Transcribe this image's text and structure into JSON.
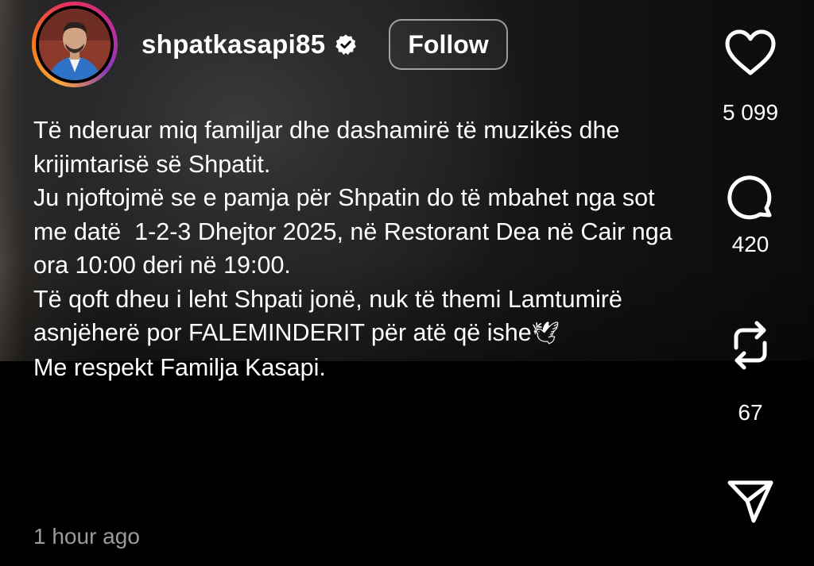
{
  "post": {
    "username": "shpatkasapi85",
    "follow_label": "Follow",
    "caption_lines": [
      "Të nderuar miq familjar dhe dashamirë të muzikës dhe krijimtarisë së Shpatit.",
      "Ju njoftojmë se e pamja për Shpatin do të mbahet nga sot me datë  1-2-3 Dhejtor 2025, në Restorant Dea në Cair nga ora 10:00 deri në 19:00.",
      "Të qoft dheu i leht Shpati jonë, nuk të themi Lamtumirë asnjëherë por FALEMINDERIT për atë që ishe",
      "Me respekt Familja Kasapi."
    ],
    "dove_emoji": "🕊",
    "time_ago": "1 hour ago"
  },
  "actions": {
    "likes": "5 099",
    "comments": "420",
    "reposts": "67"
  },
  "icons": {
    "like": "heart-icon",
    "comment": "comment-bubble-icon",
    "repost": "repost-icon",
    "share": "send-icon",
    "verified": "verified-badge-icon"
  },
  "colors": {
    "text": "#ffffff",
    "muted": "#9b9b9b",
    "background": "#000000"
  }
}
